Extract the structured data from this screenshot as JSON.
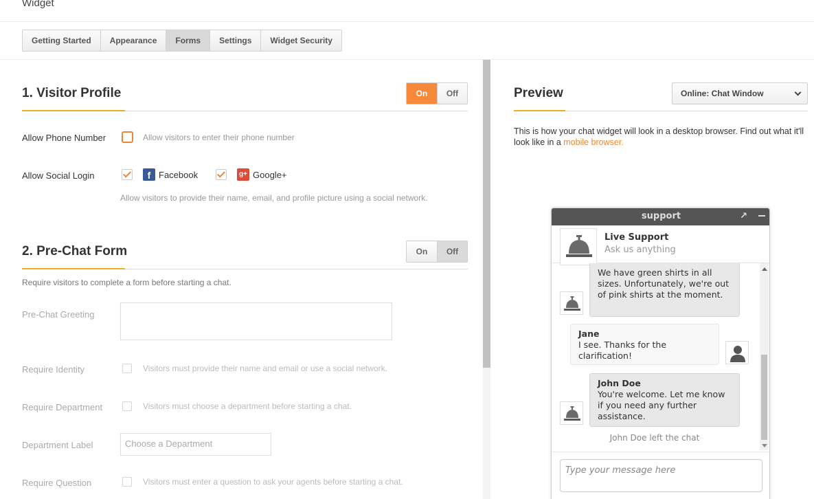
{
  "page": {
    "title": "Widget"
  },
  "tabs": [
    {
      "label": "Getting Started"
    },
    {
      "label": "Appearance"
    },
    {
      "label": "Forms",
      "active": true
    },
    {
      "label": "Settings"
    },
    {
      "label": "Widget Security"
    }
  ],
  "visitor_profile": {
    "title": "1. Visitor Profile",
    "toggle": {
      "on_label": "On",
      "off_label": "Off",
      "state": "on"
    },
    "phone": {
      "label": "Allow Phone Number",
      "hint": "Allow visitors to enter their phone number",
      "checked": false
    },
    "social": {
      "label": "Allow Social Login",
      "facebook": {
        "label": "Facebook",
        "checked": true,
        "icon": "facebook-icon"
      },
      "google": {
        "label": "Google+",
        "checked": true,
        "icon": "google-plus-icon"
      },
      "hint": "Allow visitors to provide their name, email, and profile picture using a social network."
    }
  },
  "pre_chat": {
    "title": "2. Pre-Chat Form",
    "toggle": {
      "on_label": "On",
      "off_label": "Off",
      "state": "off"
    },
    "description": "Require visitors to complete a form before starting a chat.",
    "greeting": {
      "label": "Pre-Chat Greeting",
      "value": ""
    },
    "identity": {
      "label": "Require Identity",
      "hint": "Visitors must provide their name and email or use a social network."
    },
    "department": {
      "label": "Require Department",
      "hint": "Visitors must choose a department before starting a chat."
    },
    "department_label": {
      "label": "Department Label",
      "placeholder": "Choose a Department"
    },
    "question": {
      "label": "Require Question",
      "hint": "Visitors must enter a question to ask your agents before starting a chat."
    }
  },
  "preview": {
    "title": "Preview",
    "select_value": "Online: Chat Window",
    "desc_before": "This is how your chat widget will look in a desktop browser. Find out what it'll look like in a ",
    "desc_link": "mobile browser.",
    "chat": {
      "header": "support",
      "agent_name": "Live Support",
      "agent_tagline": "Ask us anything",
      "messages": [
        {
          "who": "",
          "text": "We have green shirts in all sizes. Unfortunately, we're out of pink shirts at the moment."
        },
        {
          "who": "Jane",
          "text": "I see. Thanks for the clarification!"
        },
        {
          "who": "John Doe",
          "text": "You're welcome. Let me know if you need any further assistance."
        }
      ],
      "system": "John Doe left the chat",
      "input_placeholder": "Type your message here"
    }
  },
  "colors": {
    "accent": "#f7893a",
    "section_underline": "#f0ad2b",
    "link": "#f08a2e"
  }
}
